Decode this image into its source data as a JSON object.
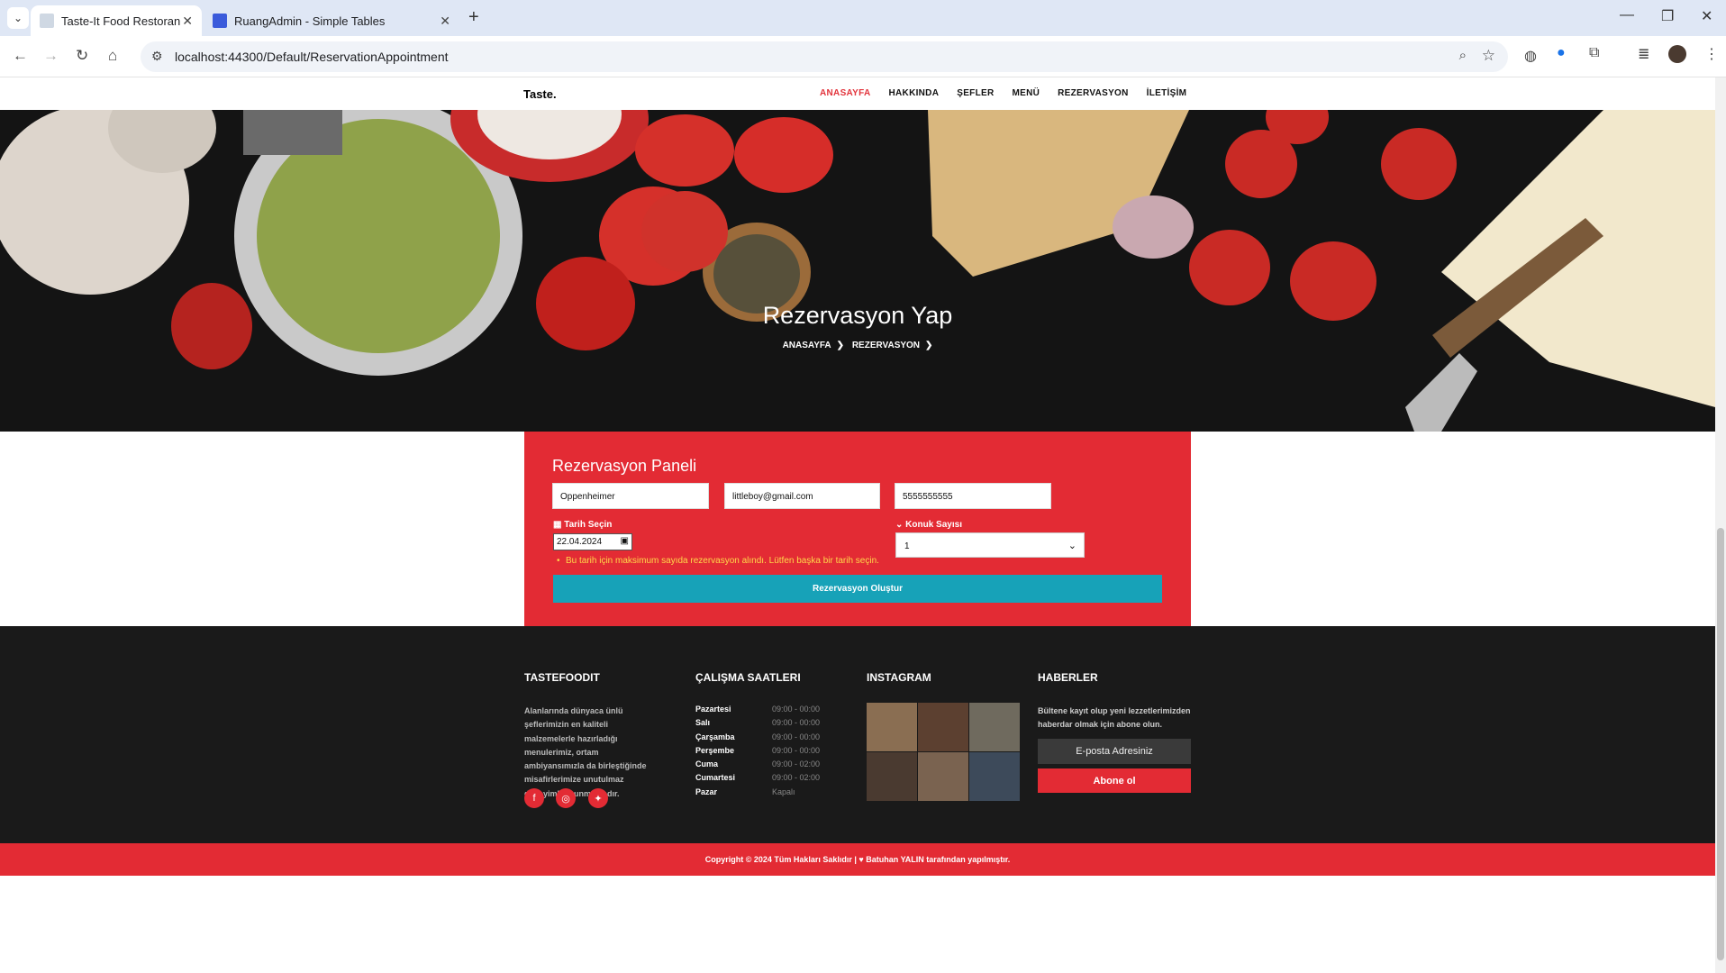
{
  "browser": {
    "tabs": [
      {
        "title": "Taste-It Food Restoran",
        "active": true
      },
      {
        "title": "RuangAdmin - Simple Tables",
        "active": false
      }
    ],
    "url": "localhost:44300/Default/ReservationAppointment"
  },
  "site": {
    "brand": "Taste.",
    "menu": [
      "ANASAYFA",
      "HAKKINDA",
      "ŞEFLER",
      "MENÜ",
      "REZERVASYON",
      "İLETİŞİM"
    ],
    "accent": "#e32b34"
  },
  "hero": {
    "title": "Rezervasyon Yap",
    "crumb1": "ANASAYFA",
    "crumb2": "REZERVASYON"
  },
  "form": {
    "title": "Rezervasyon Paneli",
    "name_value": "Oppenheimer",
    "email_value": "littleboy@gmail.com",
    "phone_value": "5555555555",
    "date_label": "Tarih Seçin",
    "date_value": "22.04.2024",
    "guests_label": "Konuk Sayısı",
    "guests_value": "1",
    "error": "Bu tarih için maksimum sayıda rezervasyon alındı. Lütfen başka bir tarih seçin.",
    "submit_label": "Rezervasyon Oluştur"
  },
  "footer": {
    "about_title": "TASTEFOODIT",
    "about_text": "Alanlarında dünyaca ünlü şeflerimizin en kaliteli malzemelerle hazırladığı menulerimiz, ortam ambiyansımızla da birleştiğinde misafirlerimize unutulmaz deneyimler sunmaktadır.",
    "hours_title": "ÇALIŞMA SAATLERI",
    "hours": [
      {
        "day": "Pazartesi",
        "time": "09:00 - 00:00"
      },
      {
        "day": "Salı",
        "time": "09:00 - 00:00"
      },
      {
        "day": "Çarşamba",
        "time": "09:00 - 00:00"
      },
      {
        "day": "Perşembe",
        "time": "09:00 - 00:00"
      },
      {
        "day": "Cuma",
        "time": "09:00 - 02:00"
      },
      {
        "day": "Cumartesi",
        "time": "09:00 - 02:00"
      },
      {
        "day": "Pazar",
        "time": "Kapalı"
      }
    ],
    "instagram_title": "INSTAGRAM",
    "news_title": "HABERLER",
    "news_text": "Bültene kayıt olup yeni lezzetlerimizden haberdar olmak için abone olun.",
    "email_placeholder": "E-posta Adresiniz",
    "subscribe_label": "Abone ol",
    "copyright": "Copyright © 2024 Tüm Hakları Saklıdır | ♥ Batuhan YALIN tarafından yapılmıştır."
  }
}
